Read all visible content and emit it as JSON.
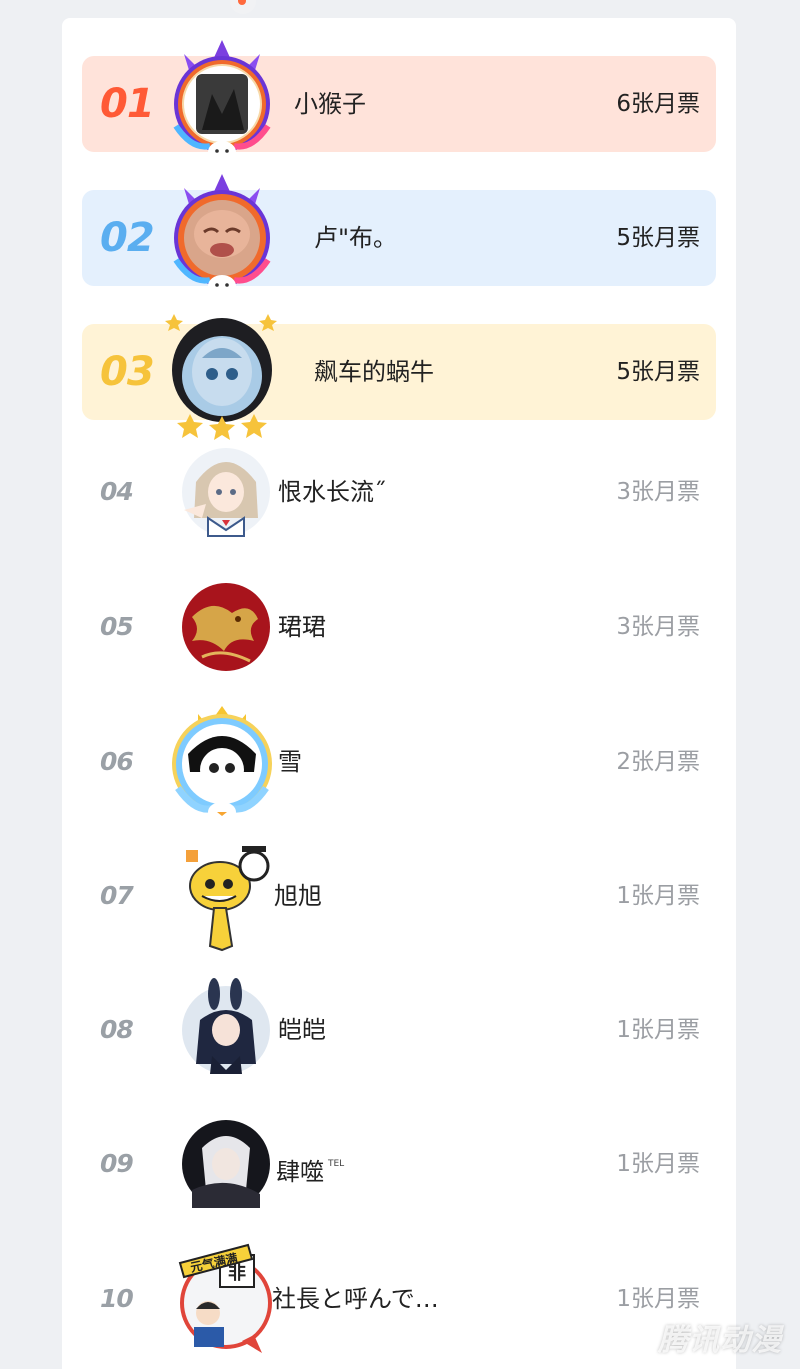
{
  "colors": {
    "rank1_bg": "#ffe3da",
    "rank2_bg": "#e4f0fd",
    "rank3_bg": "#fff3d6",
    "rank1_num": "#ff5a36",
    "rank2_num": "#5aaef0",
    "rank3_num": "#f6c33b",
    "other_num": "#9aa0a6"
  },
  "rows": [
    {
      "rank": "01",
      "name": "小猴子",
      "tickets": "6张月票",
      "avatar_icon": "avatar-dragon-frame-icon"
    },
    {
      "rank": "02",
      "name": "卢\"布。",
      "tickets": "5张月票",
      "avatar_icon": "avatar-dragon-frame-icon"
    },
    {
      "rank": "03",
      "name": "飙车的蜗牛",
      "tickets": "5张月票",
      "avatar_icon": "avatar-penguin-frame-icon"
    },
    {
      "rank": "04",
      "name": "恨水长流˝",
      "tickets": "3张月票",
      "avatar_icon": "avatar-anime-girl-icon"
    },
    {
      "rank": "05",
      "name": "珺珺",
      "tickets": "3张月票",
      "avatar_icon": "avatar-gold-dragon-icon"
    },
    {
      "rank": "06",
      "name": "雪",
      "tickets": "2张月票",
      "avatar_icon": "avatar-crown-frame-icon"
    },
    {
      "rank": "07",
      "name": "旭旭",
      "tickets": "1张月票",
      "avatar_icon": "avatar-yellow-mascot-icon"
    },
    {
      "rank": "08",
      "name": "皑皑",
      "tickets": "1张月票",
      "avatar_icon": "avatar-bunny-girl-icon"
    },
    {
      "rank": "09",
      "name": "肆噬",
      "name_sup": "TEL",
      "tickets": "1张月票",
      "avatar_icon": "avatar-white-hair-icon"
    },
    {
      "rank": "10",
      "name": "社長と呼んで…",
      "tickets": "1张月票",
      "avatar_icon": "avatar-badge-frame-icon"
    }
  ],
  "watermark": "腾讯动漫",
  "badge_text": {
    "row10_badge": "元气满满",
    "row10_sign": "非"
  }
}
